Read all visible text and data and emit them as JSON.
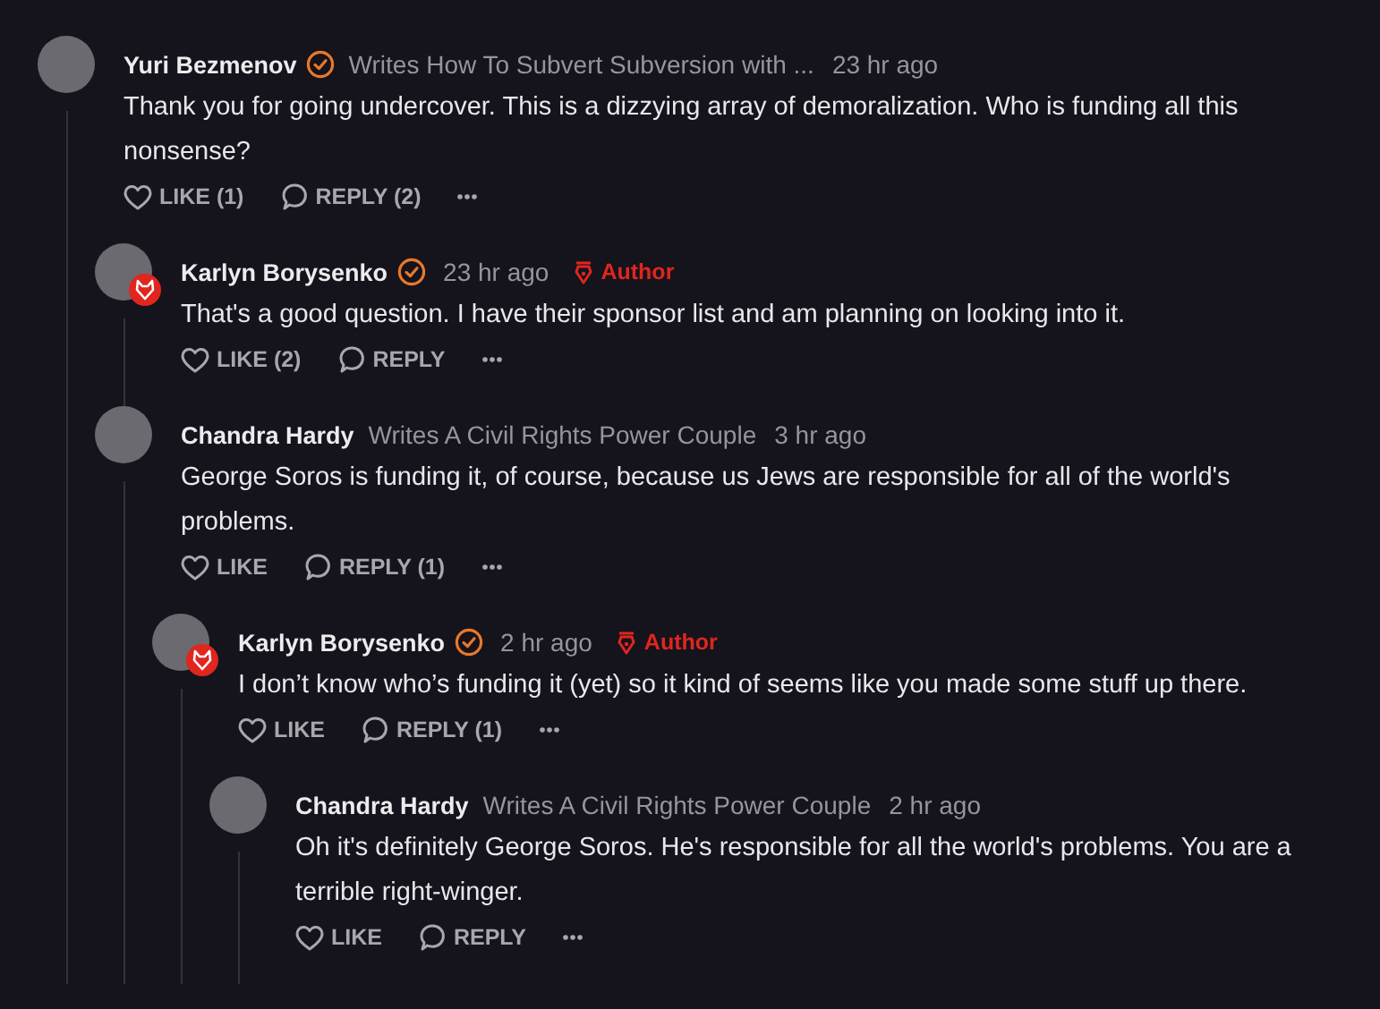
{
  "comments": [
    {
      "name": "Yuri Bezmenov",
      "verified": true,
      "byline": "Writes How To Subvert Subversion with ...",
      "time": "23 hr ago",
      "body": "Thank you for going undercover. This is a dizzying array of demoralization. Who is funding all this nonsense?",
      "like": "LIKE (1)",
      "reply": "REPLY (2)",
      "children": [
        {
          "name": "Karlyn Borysenko",
          "verified": true,
          "time": "23 hr ago",
          "author": "Author",
          "body": "That's a good question. I have their sponsor list and am planning on looking into it.",
          "like": "LIKE (2)",
          "reply": "REPLY"
        },
        {
          "name": "Chandra Hardy",
          "verified": false,
          "byline": "Writes A Civil Rights Power Couple",
          "time": "3 hr ago",
          "body": "George Soros is funding it, of course, because us Jews are responsible for all of the world's problems.",
          "like": "LIKE",
          "reply": "REPLY (1)",
          "children": [
            {
              "name": "Karlyn Borysenko",
              "verified": true,
              "time": "2 hr ago",
              "author": "Author",
              "body": "I don’t know who’s funding it (yet) so it kind of seems like you made some stuff up there.",
              "like": "LIKE",
              "reply": "REPLY (1)",
              "children": [
                {
                  "name": "Chandra Hardy",
                  "verified": false,
                  "byline": "Writes A Civil Rights Power Couple",
                  "time": "2 hr ago",
                  "body": "Oh it's definitely George Soros. He's responsible for all the world's problems. You are a terrible right-winger.",
                  "like": "LIKE",
                  "reply": "REPLY"
                }
              ]
            }
          ]
        }
      ]
    }
  ]
}
